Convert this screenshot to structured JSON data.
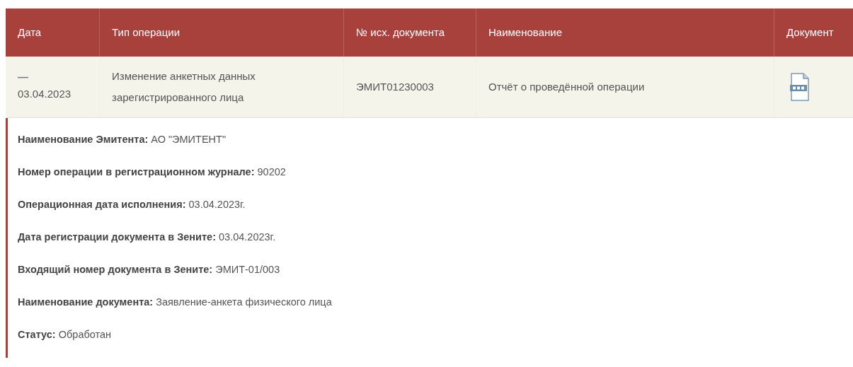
{
  "table": {
    "columns": [
      "Дата",
      "Тип операции",
      "№ исх. документа",
      "Наименование",
      "Документ"
    ],
    "rows": [
      {
        "expanded": true,
        "toggle": "—",
        "date": "03.04.2023",
        "type": "Изменение анкетных данных зарегистрированного лица",
        "doc_number": "ЭМИТ01230003",
        "name": "Отчёт о проведённой операции",
        "details": [
          {
            "label": "Наименование Эмитента:",
            "value": "АО \"ЭМИТЕНТ\""
          },
          {
            "label": "Номер операции в регистрационном журнале:",
            "value": "90202"
          },
          {
            "label": "Операционная дата исполнения:",
            "value": "03.04.2023г."
          },
          {
            "label": "Дата регистрации документа в Зените:",
            "value": "03.04.2023г."
          },
          {
            "label": "Входящий номер документа в Зените:",
            "value": "ЭМИТ-01/003"
          },
          {
            "label": "Наименование документа:",
            "value": "Заявление-анкета физического лица"
          },
          {
            "label": "Статус:",
            "value": "Обработан"
          }
        ]
      }
    ]
  }
}
